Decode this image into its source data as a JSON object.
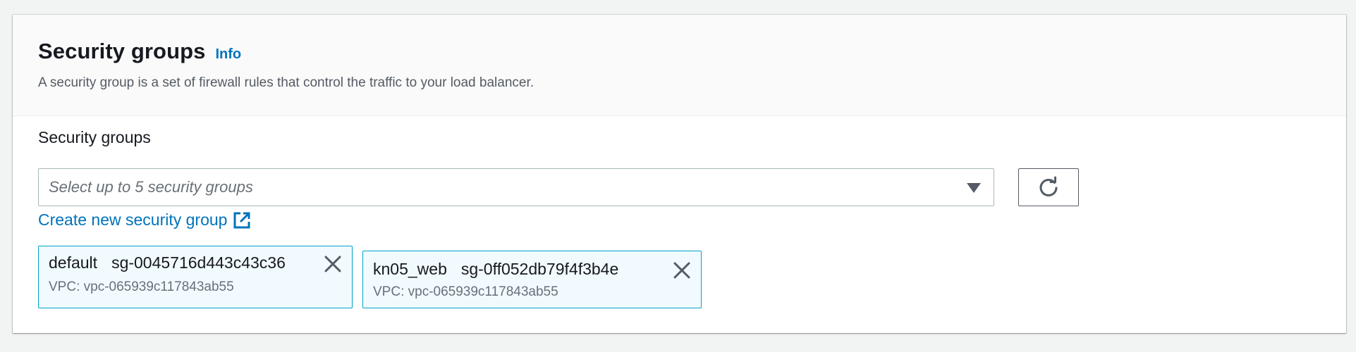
{
  "header": {
    "title": "Security groups",
    "info_link": "Info",
    "description": "A security group is a set of firewall rules that control the traffic to your load balancer."
  },
  "field": {
    "label": "Security groups",
    "placeholder": "Select up to 5 security groups",
    "create_link": "Create new security group"
  },
  "selected_groups": [
    {
      "name": "default",
      "id": "sg-0045716d443c43c36",
      "vpc": "VPC: vpc-065939c117843ab55"
    },
    {
      "name": "kn05_web",
      "id": "sg-0ff052db79f4f3b4e",
      "vpc": "VPC: vpc-065939c117843ab55"
    }
  ],
  "icons": {
    "dropdown": "caret-down-icon",
    "refresh": "refresh-icon",
    "external": "external-link-icon",
    "remove": "close-icon"
  },
  "colors": {
    "link": "#0073bb",
    "token_background": "#f1faff",
    "token_border": "#00a1c9"
  }
}
